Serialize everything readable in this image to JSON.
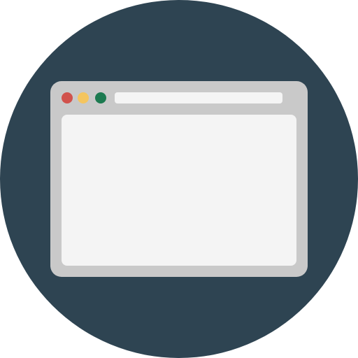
{
  "icon": {
    "name": "browser-window-icon",
    "colors": {
      "background_circle": "#2e4452",
      "window_frame": "#c9c9c9",
      "content_area": "#f4f4f4",
      "address_bar": "#f4f4f4",
      "close_dot": "#d1524c",
      "minimize_dot": "#f4c55f",
      "maximize_dot": "#1c7a50"
    }
  }
}
